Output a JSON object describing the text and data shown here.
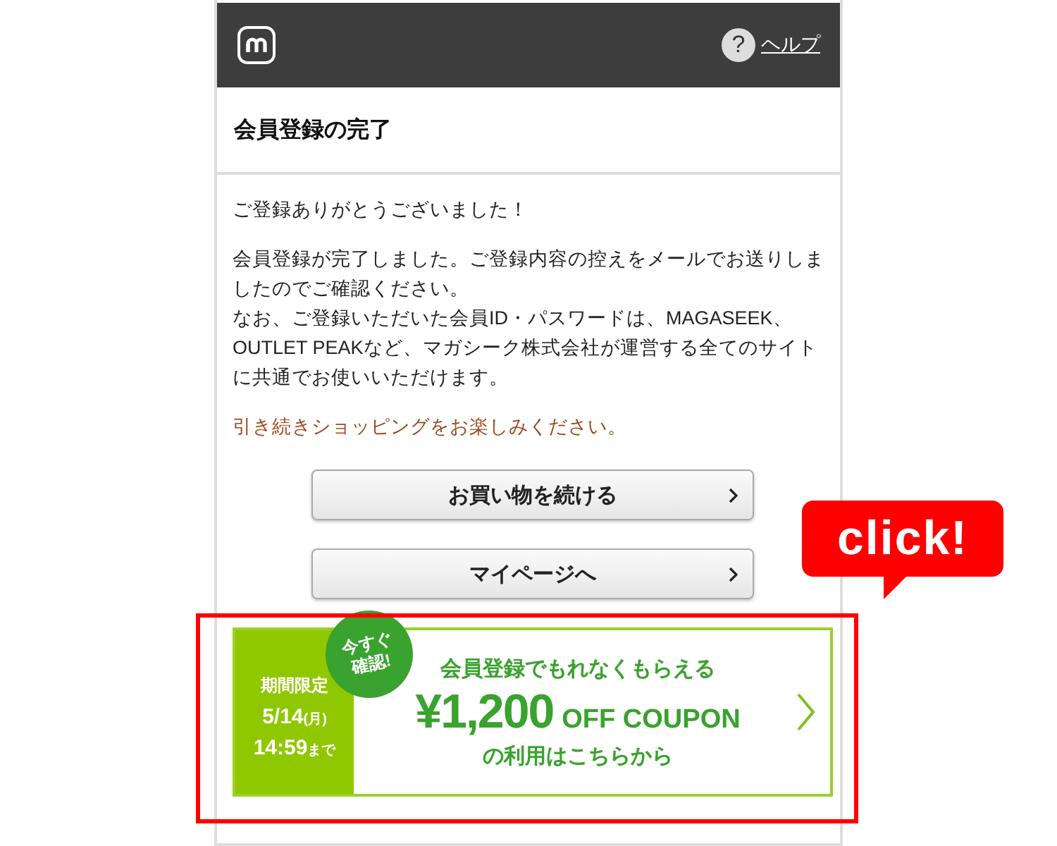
{
  "header": {
    "help_icon": "?",
    "help_link": "ヘルプ"
  },
  "page_title": "会員登録の完了",
  "greeting": "ご登録ありがとうございました！",
  "message_lines": [
    "会員登録が完了しました。ご登録内容の控えをメールでお送りしましたのでご確認ください。",
    "なお、ご登録いただいた会員ID・パスワードは、MAGASEEK、OUTLET PEAKなど、マガシーク株式会社が運営する全てのサイトに共通でお使いいただけます。"
  ],
  "closing": "引き続きショッピングをお楽しみください。",
  "buttons": [
    {
      "label": "お買い物を続ける"
    },
    {
      "label": "マイページへ"
    }
  ],
  "banner": {
    "period_label": "期間限定",
    "date": "5/14",
    "weekday": "(月)",
    "time": "14:59",
    "until": "まで",
    "badge": "今すぐ確認!",
    "headline": "会員登録でもれなくもらえる",
    "amount": "¥1,200",
    "coupon": "OFF COUPON",
    "footer": "の利用はこちらから"
  },
  "callout": "click!"
}
